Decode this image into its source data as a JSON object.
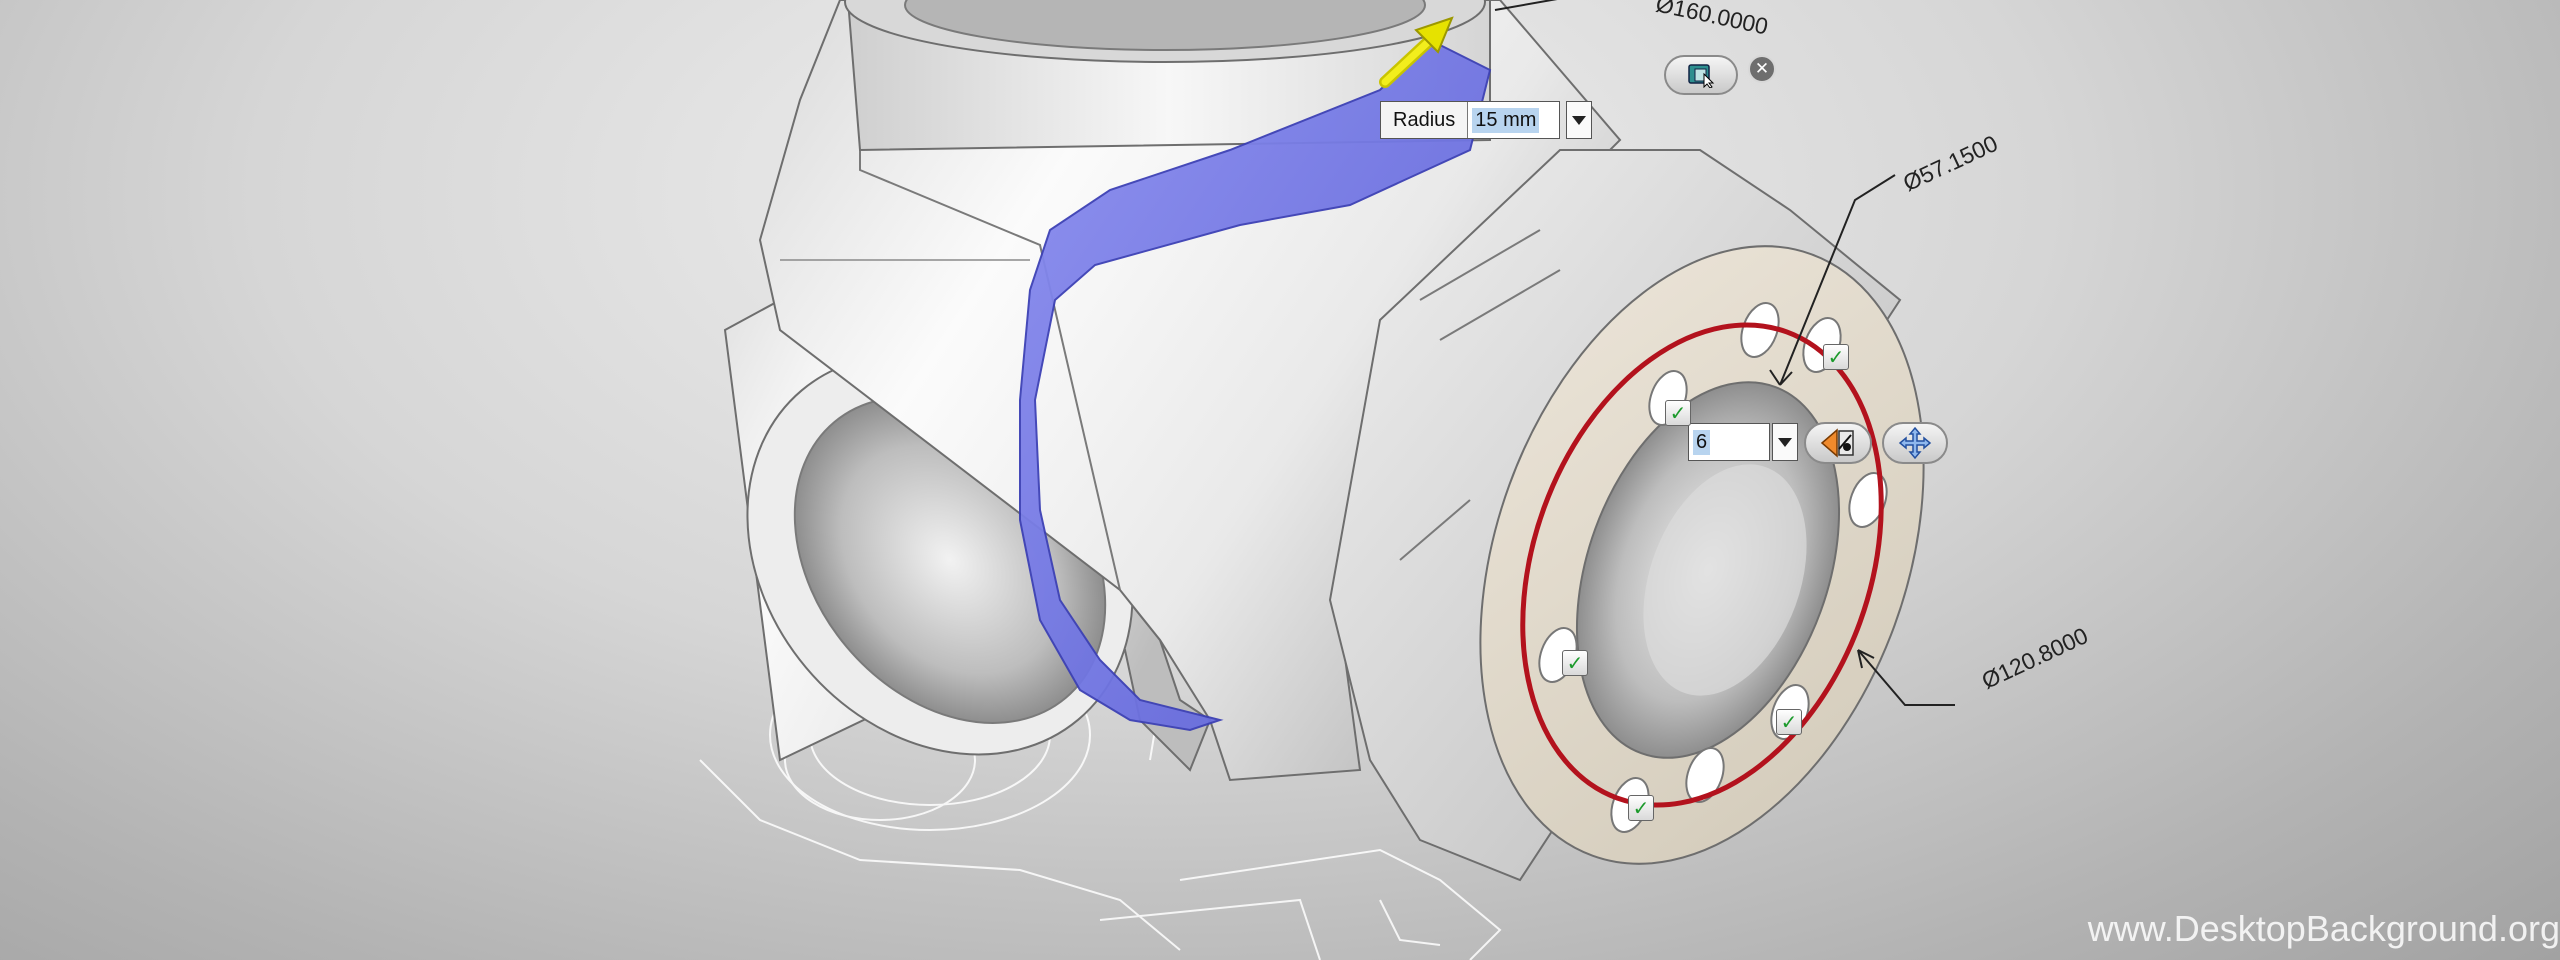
{
  "fillet_tool": {
    "label": "Radius",
    "value": "15 mm"
  },
  "pattern_tool": {
    "count_value": "6"
  },
  "dimensions": {
    "top": "Ø160.0000",
    "inner": "Ø57.1500",
    "outer": "Ø120.8000"
  },
  "watermark": "www.DesktopBackground.org",
  "colors": {
    "fillet_highlight": "#6f73e0",
    "bolt_circle": "#b3121d",
    "check_green": "#1c9a2c",
    "arrow_yellow": "#e6e200",
    "selection_blue": "#b8d4ef"
  },
  "icons": {
    "apply": "apply-icon",
    "close": "close-icon",
    "check": "checkmark-icon",
    "flip": "flip-direction-icon",
    "move": "move-handle-icon",
    "drop": "chevron-down-icon"
  }
}
